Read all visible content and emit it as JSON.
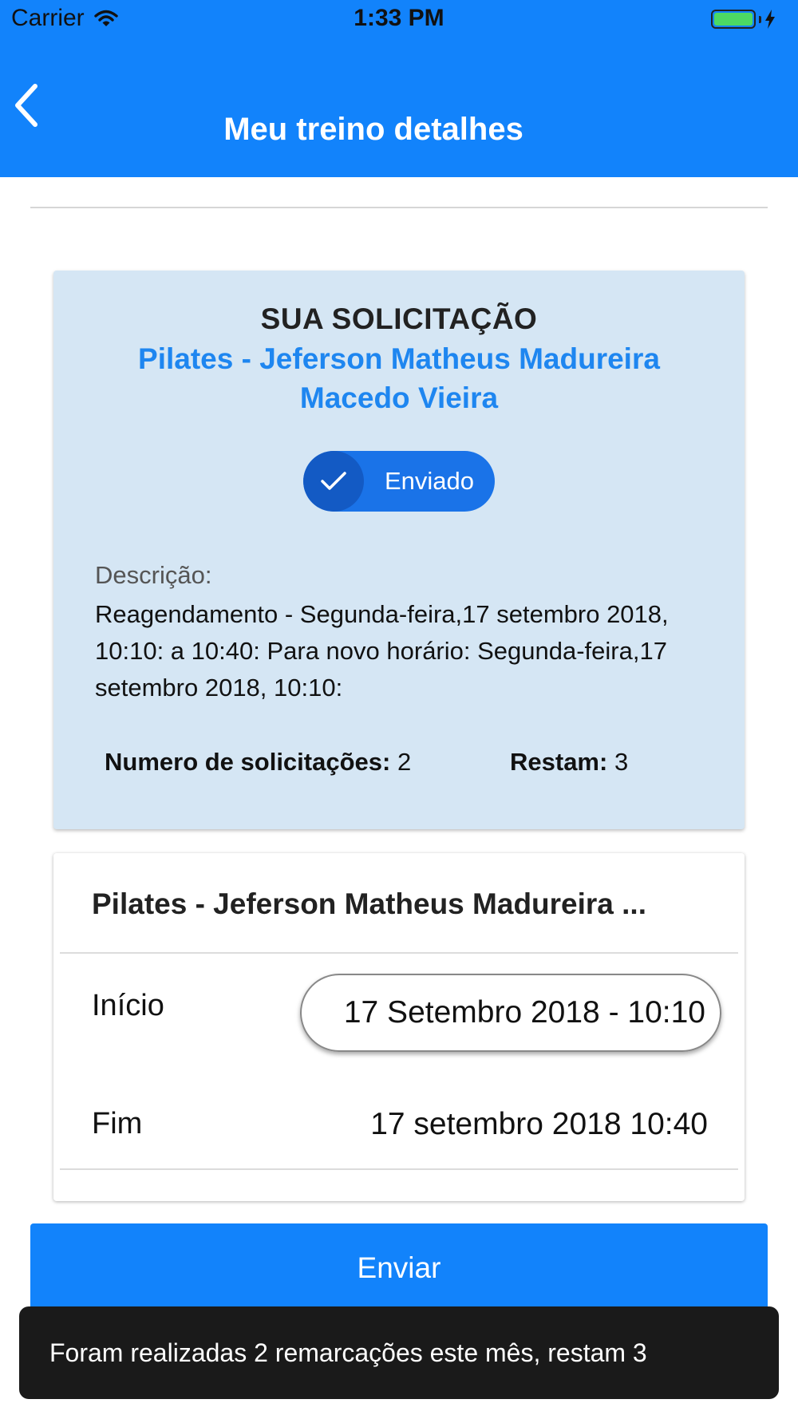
{
  "status_bar": {
    "carrier": "Carrier",
    "time": "1:33 PM"
  },
  "header": {
    "title": "Meu treino detalhes"
  },
  "request_card": {
    "heading": "SUA SOLICITAÇÃO",
    "class_name": "Pilates - Jeferson Matheus Madureira Macedo Vieira",
    "status": "Enviado",
    "description_label": "Descrição:",
    "description": "Reagendamento - Segunda-feira,17 setembro 2018, 10:10: a 10:40: Para novo horário: Segunda-feira,17 setembro 2018, 10:10:",
    "count_label": "Numero de solicitações:",
    "count_value": "2",
    "remaining_label": "Restam:",
    "remaining_value": "3"
  },
  "schedule_card": {
    "title": "Pilates - Jeferson Matheus Madureira ...",
    "start_label": "Início",
    "start_value": "17 Setembro 2018 - 10:10",
    "end_label": "Fim",
    "end_value": "17 setembro 2018 10:40"
  },
  "send_button": "Enviar",
  "toast": "Foram realizadas 2 remarcações este mês, restam 3",
  "colors": {
    "primary": "#1283fb",
    "card_bg": "#d5e6f4",
    "accent_text": "#1e86f0",
    "toast_bg": "#1a1a1a"
  }
}
